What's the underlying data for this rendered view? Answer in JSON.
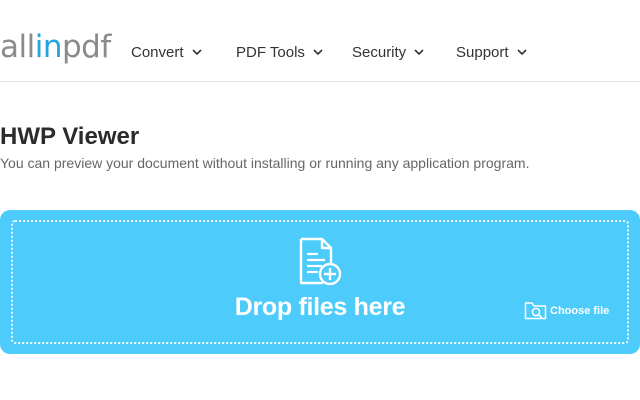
{
  "logo": {
    "part1": "all",
    "part2": "in",
    "part3": "pdf"
  },
  "nav": {
    "items": [
      {
        "label": "Convert"
      },
      {
        "label": "PDF Tools"
      },
      {
        "label": "Security"
      },
      {
        "label": "Support"
      }
    ]
  },
  "main": {
    "title": "HWP Viewer",
    "subtitle": "You can preview your document without installing or running any application program."
  },
  "dropzone": {
    "label": "Drop files here",
    "choose_file": "Choose file",
    "icon": "document-add-icon",
    "folder_icon": "folder-search-icon"
  },
  "colors": {
    "accent": "#4dcbfa",
    "logo_blue": "#26a3dc",
    "logo_gray": "#8b8b8b"
  }
}
